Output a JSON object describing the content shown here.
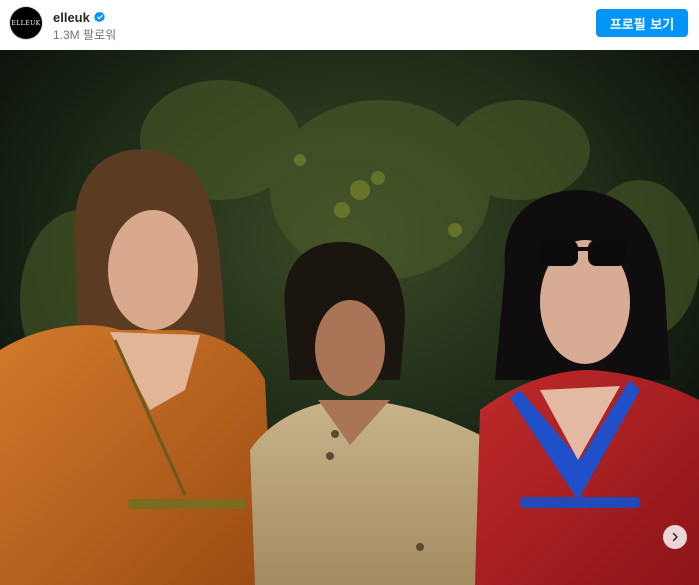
{
  "header": {
    "avatar_text": "ELLEUK",
    "username": "elleuk",
    "verified": true,
    "followers": "1.3M 팔로워",
    "profile_button": "프로필 보기"
  },
  "post": {
    "image_alt": "",
    "next_icon": "chevron-right-icon"
  },
  "colors": {
    "accent": "#0095f6",
    "verified": "#0095f6",
    "text_primary": "#262626",
    "text_secondary": "#737373"
  }
}
